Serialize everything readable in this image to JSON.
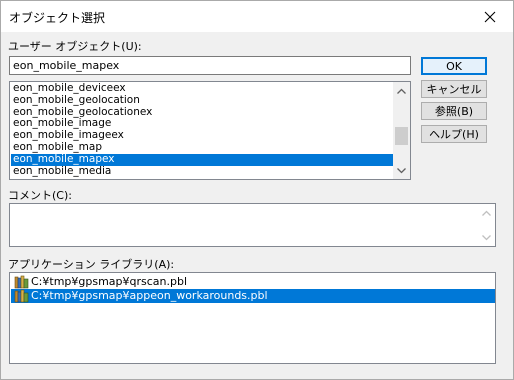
{
  "window": {
    "title": "オブジェクト選択"
  },
  "user_object": {
    "label": "ユーザー オブジェクト(U):",
    "value": "eon_mobile_mapex",
    "items": [
      "eon_mobile_deviceex",
      "eon_mobile_geolocation",
      "eon_mobile_geolocationex",
      "eon_mobile_image",
      "eon_mobile_imageex",
      "eon_mobile_map",
      "eon_mobile_mapex",
      "eon_mobile_media"
    ],
    "selected_index": 6
  },
  "buttons": {
    "ok": "OK",
    "cancel": "キャンセル",
    "browse": "参照(B)",
    "help": "ヘルプ(H)"
  },
  "comment": {
    "label": "コメント(C):",
    "value": ""
  },
  "library": {
    "label": "アプリケーション ライブラリ(A):",
    "items": [
      "C:¥tmp¥gpsmap¥qrscan.pbl",
      "C:¥tmp¥gpsmap¥appeon_workarounds.pbl"
    ],
    "selected_index": 1
  },
  "icons": {
    "close": "close-icon",
    "library_item": "library-icon",
    "scroll_up": "chevron-up-icon",
    "scroll_down": "chevron-down-icon"
  },
  "colors": {
    "selection": "#0078d7",
    "background": "#f0f0f0",
    "default_button_border": "#0078d7"
  }
}
